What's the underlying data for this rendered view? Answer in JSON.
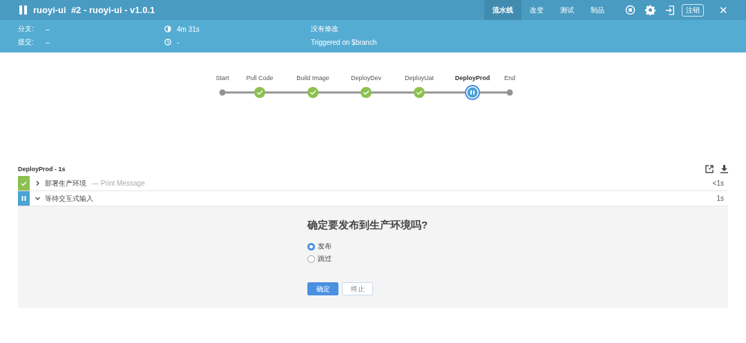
{
  "header": {
    "title": "ruoyi-ui  #2 - ruoyi-ui - v1.0.1",
    "paused": true,
    "tabs": [
      {
        "label": "流水线",
        "selected": true
      },
      {
        "label": "改变",
        "selected": false
      },
      {
        "label": "测试",
        "selected": false
      },
      {
        "label": "制品",
        "selected": false
      }
    ],
    "logout": "注销",
    "close": "✕"
  },
  "meta": {
    "branch_label": "分支:",
    "branch": "–",
    "commit_label": "提交:",
    "commit": "–",
    "duration": "4m 31s",
    "started": "-",
    "changes": "没有修改",
    "trigger": "Triggered on $branch"
  },
  "stages": [
    {
      "label": "Start",
      "kind": "terminal",
      "selected": false
    },
    {
      "label": "Pull Code",
      "kind": "success",
      "selected": false
    },
    {
      "label": "Build Image",
      "kind": "success",
      "selected": false
    },
    {
      "label": "DeployDev",
      "kind": "success",
      "selected": false
    },
    {
      "label": "DeployUat",
      "kind": "success",
      "selected": false
    },
    {
      "label": "DeployProd",
      "kind": "paused",
      "selected": true
    },
    {
      "label": "End",
      "kind": "terminal",
      "selected": false
    }
  ],
  "steps_title": "DeployProd - 1s",
  "steps": [
    {
      "kind": "success",
      "expanded": false,
      "title": "部署生产环境",
      "detail": "— Print Message",
      "duration": "<1s"
    },
    {
      "kind": "paused",
      "expanded": true,
      "title": "等待交互式输入",
      "duration": "1s"
    }
  ],
  "input": {
    "question": "确定要发布到生产环境吗?",
    "options": [
      {
        "label": "发布",
        "selected": true
      },
      {
        "label": "跳过",
        "selected": false
      }
    ],
    "buttons": [
      {
        "label": "确定",
        "kind": "primary"
      },
      {
        "label": "终止",
        "kind": "secondary"
      }
    ]
  }
}
